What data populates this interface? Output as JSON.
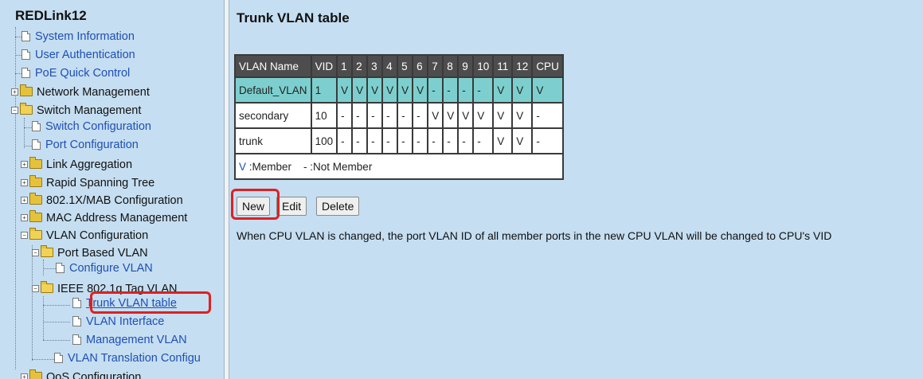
{
  "sidebar": {
    "brand": "REDLink12",
    "items": [
      {
        "label": "System Information"
      },
      {
        "label": "User Authentication"
      },
      {
        "label": "PoE Quick Control"
      },
      {
        "label": "Network Management"
      },
      {
        "label": "Switch Management"
      },
      {
        "label": "Switch Configuration"
      },
      {
        "label": "Port Configuration"
      },
      {
        "label": "Link Aggregation"
      },
      {
        "label": "Rapid Spanning Tree"
      },
      {
        "label": "802.1X/MAB Configuration"
      },
      {
        "label": "MAC Address Management"
      },
      {
        "label": "VLAN Configuration"
      },
      {
        "label": "Port Based VLAN"
      },
      {
        "label": "Configure VLAN"
      },
      {
        "label": "IEEE 802.1q Tag VLAN"
      },
      {
        "label": "Trunk VLAN table"
      },
      {
        "label": "VLAN Interface"
      },
      {
        "label": "Management VLAN"
      },
      {
        "label": "VLAN Translation Configu"
      },
      {
        "label": "QoS Configuration"
      }
    ]
  },
  "main": {
    "title": "Trunk VLAN table",
    "table": {
      "headers": [
        "VLAN Name",
        "VID",
        "1",
        "2",
        "3",
        "4",
        "5",
        "6",
        "7",
        "8",
        "9",
        "10",
        "11",
        "12",
        "CPU"
      ],
      "rows": [
        [
          "Default_VLAN",
          "1",
          "V",
          "V",
          "V",
          "V",
          "V",
          "V",
          "-",
          "-",
          "-",
          "-",
          "V",
          "V",
          "V"
        ],
        [
          "secondary",
          "10",
          "-",
          "-",
          "-",
          "-",
          "-",
          "-",
          "V",
          "V",
          "V",
          "V",
          "V",
          "V",
          "-"
        ],
        [
          "trunk",
          "100",
          "-",
          "-",
          "-",
          "-",
          "-",
          "-",
          "-",
          "-",
          "-",
          "-",
          "V",
          "V",
          "-"
        ]
      ],
      "legend_member_symbol": "V",
      "legend_member_text": " :Member",
      "legend_nonmember": "- :Not Member"
    },
    "buttons": {
      "new": "New",
      "edit": "Edit",
      "delete": "Delete"
    },
    "note": "When CPU VLAN is changed, the port VLAN ID of all member ports in the new CPU VLAN will be changed to CPU's VID"
  }
}
